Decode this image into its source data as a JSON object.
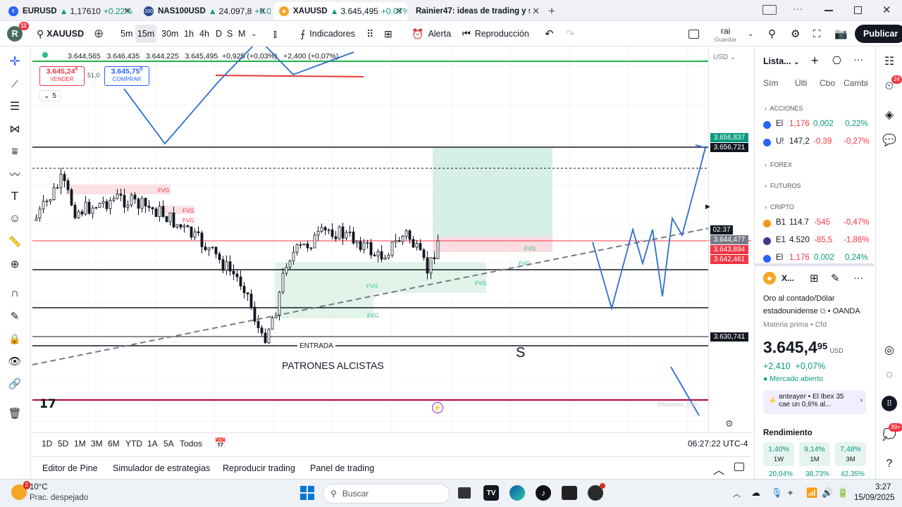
{
  "tabs": [
    {
      "symbol": "EURUSD",
      "price": "1,17610",
      "change": "+0.22%"
    },
    {
      "symbol": "NAS100USD",
      "price": "24.097,8",
      "change": "+0.0"
    },
    {
      "symbol": "XAUUSD",
      "price": "3.645,495",
      "change": "+0.07%"
    },
    {
      "title": "Rainier47: ideas de trading y sc"
    }
  ],
  "toolbar": {
    "avatar_letter": "R",
    "avatar_badge": "11",
    "symbol": "XAUUSD",
    "intervals": [
      "5m",
      "15m",
      "30m",
      "1h",
      "4h",
      "D",
      "S",
      "M"
    ],
    "indicators": "Indicadores",
    "alert": "Alerta",
    "replay": "Reproducción",
    "layout_name": "rai",
    "layout_sub": "Guardar",
    "publish": "Publicar"
  },
  "chart": {
    "ohlc": [
      "3.644,565",
      "3.646,435",
      "3.644,225",
      "3.645,495",
      "+0,925 (+0,03%)",
      "+2,400 (+0,07%)"
    ],
    "sell_price": "3.645,24",
    "sell_sup": "0",
    "sell_label": "VENDER",
    "spread": "51,0",
    "buy_price": "3.645,75",
    "buy_sup": "0",
    "buy_label": "COMPRAR",
    "indicators_count": "5",
    "currency": "USD",
    "fvg": "FVG",
    "entry": "ENTRADA",
    "patterns": "PATRONES ALCISTAS",
    "s_mark": "S",
    "watermark": "@Nephew_Sam_",
    "price_labels": [
      {
        "text": "3.656,837",
        "color": "#089981"
      },
      {
        "text": "3.656,721",
        "color": "#131722"
      },
      {
        "text": "02:37",
        "color": "#131722"
      },
      {
        "text": "3.644,477",
        "color": "#787b86"
      },
      {
        "text": "3.643,894",
        "color": "#f23645"
      },
      {
        "text": "3.642,461",
        "color": "#f23645"
      },
      {
        "text": "3.630,741",
        "color": "#131722"
      }
    ]
  },
  "ranges": [
    "1D",
    "5D",
    "1M",
    "3M",
    "6M",
    "YTD",
    "1A",
    "5A",
    "Todos"
  ],
  "time": "06:27:22 UTC-4",
  "bottom_tabs": [
    "Editor de Pine",
    "Simulador de estrategias",
    "Reproducir trading",
    "Panel de trading"
  ],
  "watchlist": {
    "title": "Lista...",
    "cols": [
      "Sím",
      "Últi",
      "Cbo",
      "Cambi"
    ],
    "sections": [
      "ACCIONES",
      "FOREX",
      "FUTUROS",
      "CRIPTO"
    ],
    "stocks": [
      {
        "sym": "El",
        "last": "1,176",
        "chg": "0,002",
        "pct": "0,22%"
      },
      {
        "sym": "U!",
        "last": "147,2",
        "chg": "-0,39",
        "pct": "-0,27%"
      }
    ],
    "crypto": [
      {
        "sym": "B1",
        "last": "114.7",
        "chg": "-545",
        "pct": "-0,47%"
      },
      {
        "sym": "E1",
        "last": "4.520",
        "chg": "-85,5",
        "pct": "-1,86%"
      },
      {
        "sym": "El",
        "last": "1,176",
        "chg": "0,002",
        "pct": "0,24%"
      }
    ]
  },
  "details": {
    "symbol": "X...",
    "name1": "Oro al contado/Dólar",
    "name2": "estadounidense",
    "broker": "OANDA",
    "type": "Materia prima • Cfd",
    "price": "3.645,4",
    "price_small": "95",
    "currency": "USD",
    "change": "+2,410",
    "change_pct": "+0,07%",
    "market": "Mercado abierto",
    "news_when": "anteayer",
    "news1": "El Ibex 35",
    "news2": "cae un 0,6% al...",
    "perf_title": "Rendimiento",
    "perf": [
      {
        "value": "1,40%",
        "label": "1W"
      },
      {
        "value": "9,14%",
        "label": "1M"
      },
      {
        "value": "7,48%",
        "label": "3M"
      }
    ],
    "perf2": [
      "20,04%",
      "38,73%",
      "42,35%"
    ]
  },
  "rightbar": {
    "badge1": "24",
    "badge2": "99+"
  },
  "taskbar": {
    "weather_badge": "2",
    "temp": "10°C",
    "weather": "Prac. despejado",
    "search": "Buscar",
    "time": "3:27",
    "date": "15/09/2025"
  }
}
